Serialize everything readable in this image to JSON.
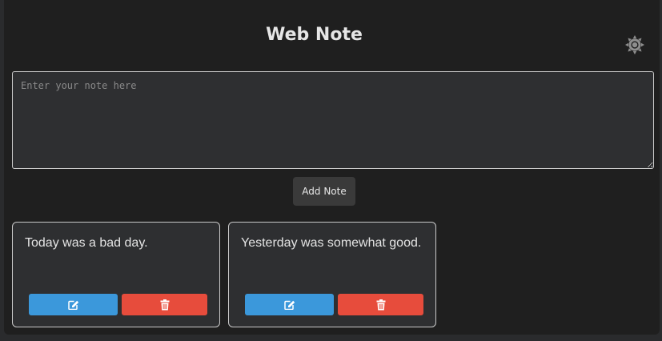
{
  "header": {
    "title": "Web Note",
    "theme_icon": "sun-icon"
  },
  "editor": {
    "placeholder": "Enter your note here",
    "value": "",
    "add_label": "Add Note"
  },
  "notes": [
    {
      "text": "Today was a bad day.",
      "edit_icon": "edit-icon",
      "delete_icon": "trash-icon"
    },
    {
      "text": "Yesterday was somewhat good.",
      "edit_icon": "edit-icon",
      "delete_icon": "trash-icon"
    }
  ],
  "colors": {
    "background": "#1f1f1f",
    "card": "#2e2f31",
    "edit": "#3b98db",
    "delete": "#e74c3c",
    "button": "#3a3a3a"
  }
}
